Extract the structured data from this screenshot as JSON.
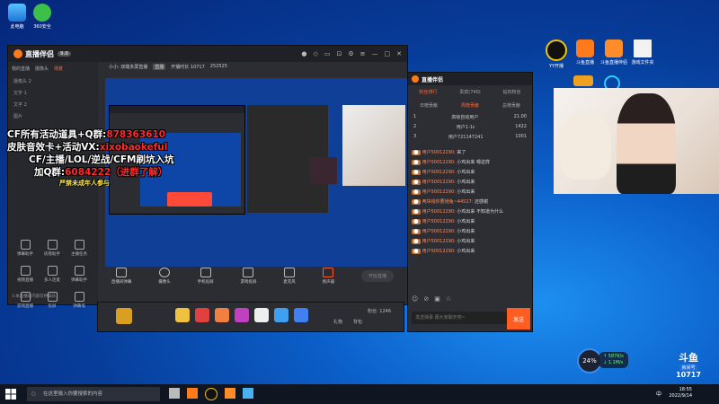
{
  "desktop": {
    "icons_left": [
      {
        "label": "此电脑"
      },
      {
        "label": "360安全"
      }
    ],
    "icons_right": [
      {
        "label": "YY开播"
      },
      {
        "label": "斗鱼直播"
      },
      {
        "label": "斗鱼直播伴侣"
      },
      {
        "label": "游戏文件夹"
      }
    ]
  },
  "mainwin": {
    "app_name": "直播伴侣",
    "badge": "9.0",
    "left_tabs": [
      {
        "label": "我的直播"
      },
      {
        "label": "摄像头"
      },
      {
        "label": "场景"
      }
    ],
    "scenes": [
      {
        "label": "摄像头 2"
      },
      {
        "label": "文字 1"
      },
      {
        "label": "文字 2"
      },
      {
        "label": "图片"
      }
    ],
    "tools": [
      {
        "label": "弹幕助手"
      },
      {
        "label": "房管助手"
      },
      {
        "label": "主播任务"
      },
      {
        "label": "视频直播"
      },
      {
        "label": "多人连麦"
      },
      {
        "label": "弹幕助手"
      },
      {
        "label": "游戏直播"
      },
      {
        "label": "投屏"
      },
      {
        "label": "弹幕墙"
      }
    ],
    "info_row": [
      {
        "label": "小小: 双端多屏直播"
      },
      {
        "label": "直播"
      },
      {
        "label": "开播时长 10717"
      },
      {
        "label": "252525"
      }
    ],
    "bottom_bar": [
      {
        "label": "直播间弹幕"
      },
      {
        "label": "摄像头"
      },
      {
        "label": "手机投屏"
      },
      {
        "label": "游戏投屏"
      },
      {
        "label": "麦克风"
      },
      {
        "label": "扬声器"
      }
    ],
    "start_button": "开始直播",
    "footer_left": "3.本直播间内容仅供娱乐"
  },
  "gift_bar": {
    "labels": [
      {
        "label": "礼物"
      },
      {
        "label": "背包"
      }
    ],
    "count_label": "粉丝: 1246"
  },
  "chat": {
    "tabs": [
      {
        "label": "粉丝排行"
      },
      {
        "label": "贵宾(740)"
      },
      {
        "label": "钻石粉丝"
      }
    ],
    "subtabs": [
      {
        "label": "日榜贡献"
      },
      {
        "label": "周榜贡献"
      },
      {
        "label": "总榜贡献"
      }
    ],
    "ranks": [
      {
        "pos": "1",
        "name": "高级自动用户",
        "val": "21.00"
      },
      {
        "pos": "2",
        "name": "用户1-1c",
        "val": "1422"
      },
      {
        "pos": "3",
        "name": "用户721147241",
        "val": "1001"
      }
    ],
    "messages": [
      {
        "user": "用户50012290:",
        "text": "来了"
      },
      {
        "user": "用户50012290:",
        "text": "小鸡出来",
        "extra": "嗯这样"
      },
      {
        "user": "用户50012290:",
        "text": "小鸡出来"
      },
      {
        "user": "用户50012290:",
        "text": "小鸡出来"
      },
      {
        "user": "用户50012290:",
        "text": "小鸡出来"
      },
      {
        "user": "两块钱你要她兔~44527:",
        "text": "还感谢"
      },
      {
        "user": "用户50012290:",
        "text": "小鸡出来",
        "extra": "不知道为什么"
      },
      {
        "user": "用户50012290:",
        "text": "小鸡出来"
      },
      {
        "user": "用户50012290:",
        "text": "小鸡出来"
      },
      {
        "user": "用户50012290:",
        "text": "小鸡出来"
      },
      {
        "user": "用户50012290:",
        "text": "小鸡出来"
      }
    ],
    "input_placeholder": "发送弹幕 跟大家聊天吧~",
    "send_label": "发送"
  },
  "promo": {
    "line1_a": "CF所有活动道具+Q群:",
    "line1_b": "878363610",
    "line2_a": "皮肤音效卡+活动VX:",
    "line2_b": "xixobaokeful",
    "line3": "CF/主播/LOL/逆战/CFM刷坑入坑",
    "line4_a": "加Q群:",
    "line4_b": "6084222（进群了解）",
    "warning": "严禁未成年人参与"
  },
  "taskbar": {
    "search_placeholder": "在这里输入你要搜索的内容",
    "time": "18:55",
    "date": "2022/9/14",
    "lang": "中"
  },
  "brand": {
    "name": "斗鱼",
    "room_label": "房间号",
    "room_id": "10717"
  },
  "gauge": {
    "value": "24%"
  },
  "speed": {
    "up": "↑ 587K/s",
    "down": "↓ 1.1M/s"
  }
}
